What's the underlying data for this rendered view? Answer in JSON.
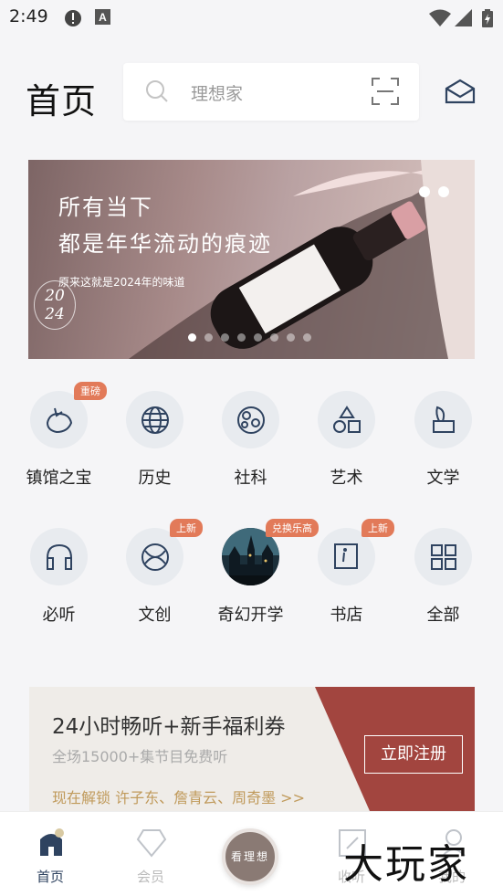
{
  "status_bar": {
    "time": "2:49",
    "icons": [
      "alert-icon",
      "a-keyboard-icon",
      "wifi-icon",
      "signal-icon",
      "battery-icon"
    ]
  },
  "header": {
    "title": "首页",
    "search_placeholder": "理想家"
  },
  "banner": {
    "line1": "所有当下",
    "line2": "都是年华流动的痕迹",
    "subtitle": "原来这就是2024年的味道",
    "year_top": "20",
    "year_bottom": "24",
    "slide_count": 8,
    "active_slide": 1
  },
  "categories": [
    {
      "label": "镇馆之宝",
      "icon": "treasure-icon",
      "badge": "重磅"
    },
    {
      "label": "历史",
      "icon": "globe-icon",
      "badge": ""
    },
    {
      "label": "社科",
      "icon": "molecule-icon",
      "badge": ""
    },
    {
      "label": "艺术",
      "icon": "shapes-icon",
      "badge": ""
    },
    {
      "label": "文学",
      "icon": "quill-icon",
      "badge": ""
    },
    {
      "label": "必听",
      "icon": "headphones-icon",
      "badge": ""
    },
    {
      "label": "文创",
      "icon": "creative-icon",
      "badge": "上新"
    },
    {
      "label": "奇幻开学",
      "icon": "castle-image",
      "badge": "兑换乐高"
    },
    {
      "label": "书店",
      "icon": "book-icon",
      "badge": "上新"
    },
    {
      "label": "全部",
      "icon": "grid-icon",
      "badge": ""
    }
  ],
  "promo": {
    "title": "24小时畅听+新手福利券",
    "subtitle": "全场15000+集节目免费听",
    "unlock": "现在解锁  许子东、詹青云、周奇墨  >>",
    "button": "立即注册"
  },
  "bottom_nav": {
    "items": [
      {
        "label": "首页",
        "icon": "home-icon",
        "active": true
      },
      {
        "label": "会员",
        "icon": "diamond-icon",
        "active": false
      },
      {
        "label": "看理想",
        "icon": "center-logo",
        "active": false
      },
      {
        "label": "收听",
        "icon": "listen-icon",
        "active": false
      },
      {
        "label": "我的",
        "icon": "profile-icon",
        "active": false
      }
    ]
  },
  "watermark": "大玩家",
  "colors": {
    "accent_badge": "#e27a59",
    "promo_red": "#a2453f",
    "icon_navy": "#2f4360",
    "icon_circle": "#e8ebef"
  }
}
